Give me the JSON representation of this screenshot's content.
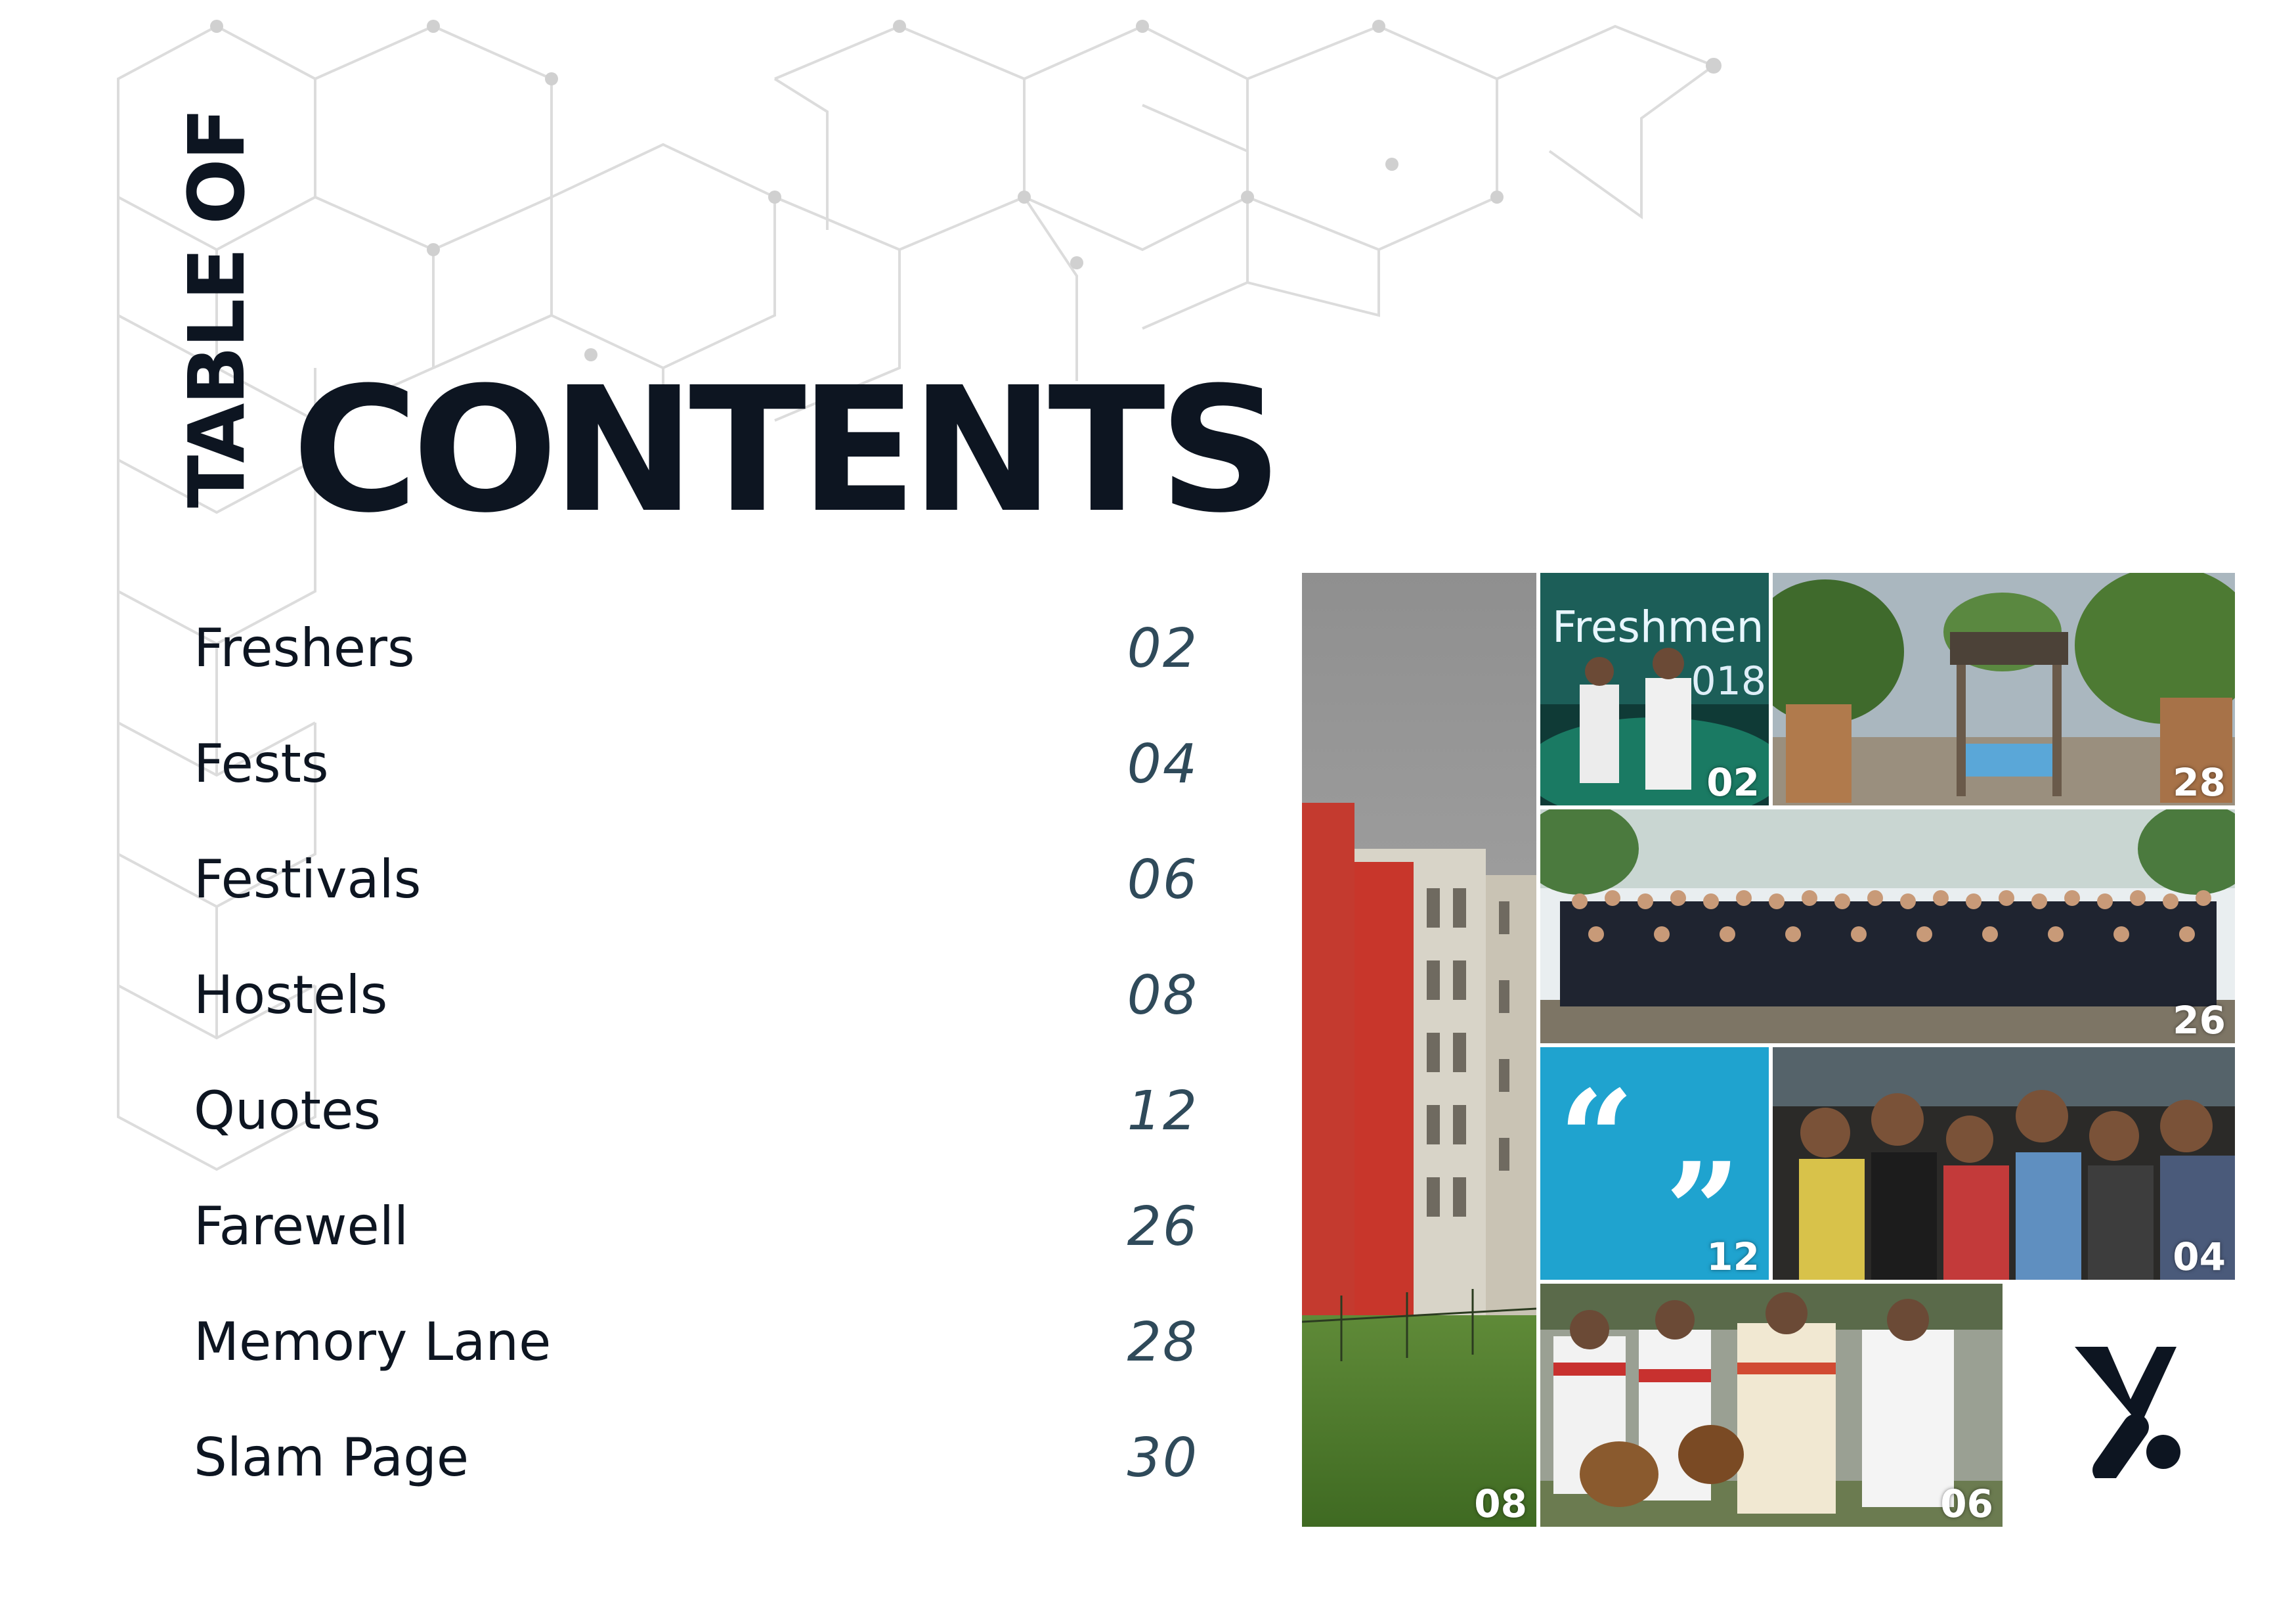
{
  "header": {
    "title_vertical": "TABLE OF",
    "title_main": "CONTENTS"
  },
  "toc": [
    {
      "label": "Freshers",
      "page": "02"
    },
    {
      "label": "Fests",
      "page": "04"
    },
    {
      "label": "Festivals",
      "page": "06"
    },
    {
      "label": "Hostels",
      "page": "08"
    },
    {
      "label": "Quotes",
      "page": "12"
    },
    {
      "label": "Farewell",
      "page": "26"
    },
    {
      "label": "Memory Lane",
      "page": "28"
    },
    {
      "label": "Slam Page",
      "page": "30"
    }
  ],
  "collage": {
    "freshers": {
      "page": "02",
      "sign_text": "Freshmen",
      "year_text": "018"
    },
    "memory_lane": {
      "page": "28"
    },
    "farewell": {
      "page": "26"
    },
    "quotes": {
      "page": "12"
    },
    "fests": {
      "page": "04"
    },
    "hostels": {
      "page": "08"
    },
    "festivals": {
      "page": "06"
    }
  },
  "colors": {
    "text_dark": "#0d1521",
    "page_number": "#2f4a5a",
    "quote_tile": "#1fa3cf",
    "pattern_line": "#d6d6d6"
  }
}
